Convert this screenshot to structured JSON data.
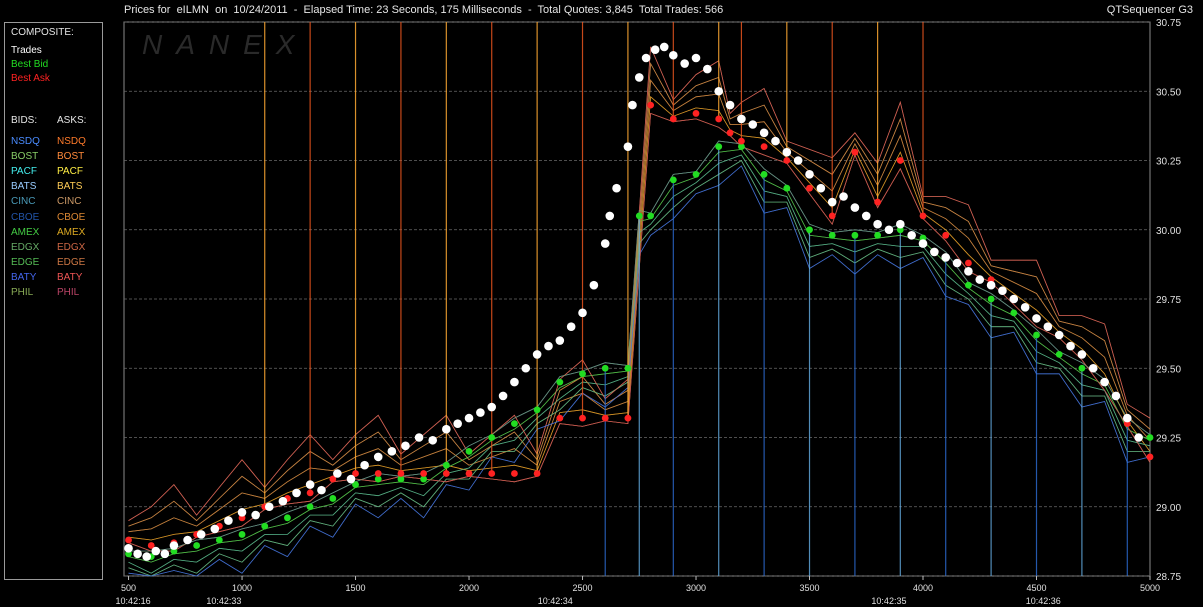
{
  "header": {
    "title": "Prices for  eILMN  on  10/24/2011  -  Elapsed Time: 23 Seconds, 175 Milliseconds  -  Total Quotes: 3,845  Total Trades: 566",
    "app": "QTSequencer G3",
    "watermark": "NANEX"
  },
  "legend": {
    "composite_label": "COMPOSITE:",
    "composite": [
      {
        "label": "Trades",
        "color": "#ffffff"
      },
      {
        "label": "Best Bid",
        "color": "#22dd22"
      },
      {
        "label": "Best Ask",
        "color": "#ff2222"
      }
    ],
    "bids_label": "BIDS:",
    "asks_label": "ASKS:",
    "exchanges": [
      {
        "bid": "NSDQ",
        "bid_color": "#4a8cff",
        "ask": "NSDQ",
        "ask_color": "#ff7a2a"
      },
      {
        "bid": "BOST",
        "bid_color": "#88cc66",
        "ask": "BOST",
        "ask_color": "#ff8a3a"
      },
      {
        "bid": "PACF",
        "bid_color": "#44eeee",
        "ask": "PACF",
        "ask_color": "#ffee44"
      },
      {
        "bid": "BATS",
        "bid_color": "#99ccff",
        "ask": "BATS",
        "ask_color": "#ffcc55"
      },
      {
        "bid": "CINC",
        "bid_color": "#4a9ab8",
        "ask": "CINC",
        "ask_color": "#cc9966"
      },
      {
        "bid": "CBOE",
        "bid_color": "#2255aa",
        "ask": "CBOE",
        "ask_color": "#dd8833"
      },
      {
        "bid": "AMEX",
        "bid_color": "#44cc44",
        "ask": "AMEX",
        "ask_color": "#ddaa22"
      },
      {
        "bid": "EDGX",
        "bid_color": "#66aa66",
        "ask": "EDGX",
        "ask_color": "#cc6644"
      },
      {
        "bid": "EDGE",
        "bid_color": "#55bb55",
        "ask": "EDGE",
        "ask_color": "#cc7744"
      },
      {
        "bid": "BATY",
        "bid_color": "#4466ee",
        "ask": "BATY",
        "ask_color": "#ee5555"
      },
      {
        "bid": "PHIL",
        "bid_color": "#88aa55",
        "ask": "PHIL",
        "ask_color": "#bb4466"
      }
    ]
  },
  "chart_data": {
    "type": "scatter",
    "title": "Prices for  eILMN  on  10/24/2011",
    "ylim": [
      28.75,
      30.75
    ],
    "xlim": [
      480,
      5000
    ],
    "y_ticks": [
      "28.75",
      "29.00",
      "29.25",
      "29.50",
      "29.75",
      "30.00",
      "30.25",
      "30.50",
      "30.75"
    ],
    "x_ticks": [
      "500",
      "1000",
      "1500",
      "2000",
      "2500",
      "3000",
      "3500",
      "4000",
      "4500",
      "5000"
    ],
    "time_labels": [
      {
        "x": 520,
        "label": "10:42:16"
      },
      {
        "x": 920,
        "label": "10:42:33"
      },
      {
        "x": 2380,
        "label": "10:42:34"
      },
      {
        "x": 3850,
        "label": "10:42:35"
      },
      {
        "x": 4530,
        "label": "10:42:36"
      }
    ],
    "grid": true,
    "series": [
      {
        "name": "Trades",
        "color": "#ffffff",
        "x": [
          500,
          540,
          580,
          620,
          660,
          700,
          760,
          820,
          880,
          940,
          1000,
          1060,
          1120,
          1180,
          1240,
          1300,
          1350,
          1420,
          1480,
          1540,
          1600,
          1660,
          1720,
          1780,
          1840,
          1900,
          1950,
          2000,
          2050,
          2100,
          2150,
          2200,
          2250,
          2300,
          2350,
          2400,
          2450,
          2500,
          2550,
          2600,
          2620,
          2650,
          2700,
          2720,
          2750,
          2780,
          2820,
          2860,
          2900,
          2950,
          3000,
          3050,
          3100,
          3150,
          3200,
          3250,
          3300,
          3350,
          3400,
          3450,
          3500,
          3550,
          3600,
          3650,
          3700,
          3750,
          3800,
          3850,
          3900,
          3950,
          4000,
          4050,
          4100,
          4150,
          4200,
          4250,
          4300,
          4350,
          4400,
          4450,
          4500,
          4550,
          4600,
          4650,
          4700,
          4750,
          4800,
          4850,
          4900,
          4950
        ],
        "y": [
          28.85,
          28.83,
          28.82,
          28.84,
          28.83,
          28.86,
          28.88,
          28.9,
          28.92,
          28.95,
          28.98,
          28.97,
          29.0,
          29.02,
          29.05,
          29.08,
          29.06,
          29.12,
          29.1,
          29.15,
          29.18,
          29.2,
          29.22,
          29.25,
          29.24,
          29.28,
          29.3,
          29.32,
          29.34,
          29.36,
          29.4,
          29.45,
          29.5,
          29.55,
          29.58,
          29.6,
          29.65,
          29.7,
          29.8,
          29.95,
          30.05,
          30.15,
          30.3,
          30.45,
          30.55,
          30.62,
          30.65,
          30.66,
          30.63,
          30.6,
          30.62,
          30.58,
          30.5,
          30.45,
          30.4,
          30.38,
          30.35,
          30.32,
          30.28,
          30.25,
          30.2,
          30.15,
          30.1,
          30.12,
          30.08,
          30.05,
          30.02,
          30.0,
          30.02,
          29.98,
          29.95,
          29.92,
          29.9,
          29.88,
          29.85,
          29.82,
          29.8,
          29.78,
          29.75,
          29.72,
          29.68,
          29.65,
          29.62,
          29.58,
          29.55,
          29.5,
          29.45,
          29.4,
          29.32,
          29.25
        ]
      },
      {
        "name": "Best Bid",
        "color": "#22dd22",
        "x": [
          500,
          600,
          700,
          800,
          900,
          1000,
          1100,
          1200,
          1300,
          1400,
          1500,
          1600,
          1700,
          1800,
          1900,
          2000,
          2100,
          2200,
          2300,
          2400,
          2500,
          2600,
          2700,
          2750,
          2800,
          2900,
          3000,
          3100,
          3200,
          3300,
          3400,
          3500,
          3600,
          3700,
          3800,
          3900,
          4000,
          4100,
          4200,
          4300,
          4400,
          4500,
          4600,
          4700,
          4800,
          4900,
          5000
        ],
        "y": [
          28.83,
          28.82,
          28.84,
          28.86,
          28.88,
          28.9,
          28.93,
          28.96,
          29.0,
          29.03,
          29.08,
          29.1,
          29.1,
          29.1,
          29.15,
          29.2,
          29.25,
          29.3,
          29.35,
          29.45,
          29.48,
          29.5,
          29.5,
          30.05,
          30.05,
          30.18,
          30.2,
          30.3,
          30.3,
          30.2,
          30.15,
          30.0,
          29.98,
          29.98,
          29.98,
          30.0,
          29.97,
          29.9,
          29.8,
          29.75,
          29.7,
          29.62,
          29.55,
          29.5,
          29.45,
          29.3,
          29.25
        ]
      },
      {
        "name": "Best Ask",
        "color": "#ff2222",
        "x": [
          500,
          600,
          700,
          800,
          900,
          1000,
          1100,
          1200,
          1300,
          1400,
          1500,
          1600,
          1700,
          1800,
          1900,
          2000,
          2100,
          2200,
          2300,
          2400,
          2500,
          2600,
          2700,
          2800,
          2900,
          3000,
          3100,
          3150,
          3200,
          3300,
          3400,
          3500,
          3600,
          3700,
          3800,
          3900,
          4000,
          4100,
          4200,
          4300,
          4400,
          4500,
          4600,
          4700,
          4800,
          4900,
          5000
        ],
        "y": [
          28.88,
          28.86,
          28.87,
          28.9,
          28.93,
          28.96,
          29.0,
          29.03,
          29.05,
          29.1,
          29.12,
          29.12,
          29.12,
          29.12,
          29.12,
          29.12,
          29.12,
          29.12,
          29.12,
          29.32,
          29.32,
          29.32,
          29.32,
          30.45,
          30.4,
          30.42,
          30.4,
          30.35,
          30.32,
          30.3,
          30.25,
          30.15,
          30.05,
          30.28,
          30.1,
          30.25,
          30.05,
          29.98,
          29.88,
          29.82,
          29.75,
          29.68,
          29.62,
          29.55,
          29.45,
          29.3,
          29.18
        ]
      }
    ]
  }
}
